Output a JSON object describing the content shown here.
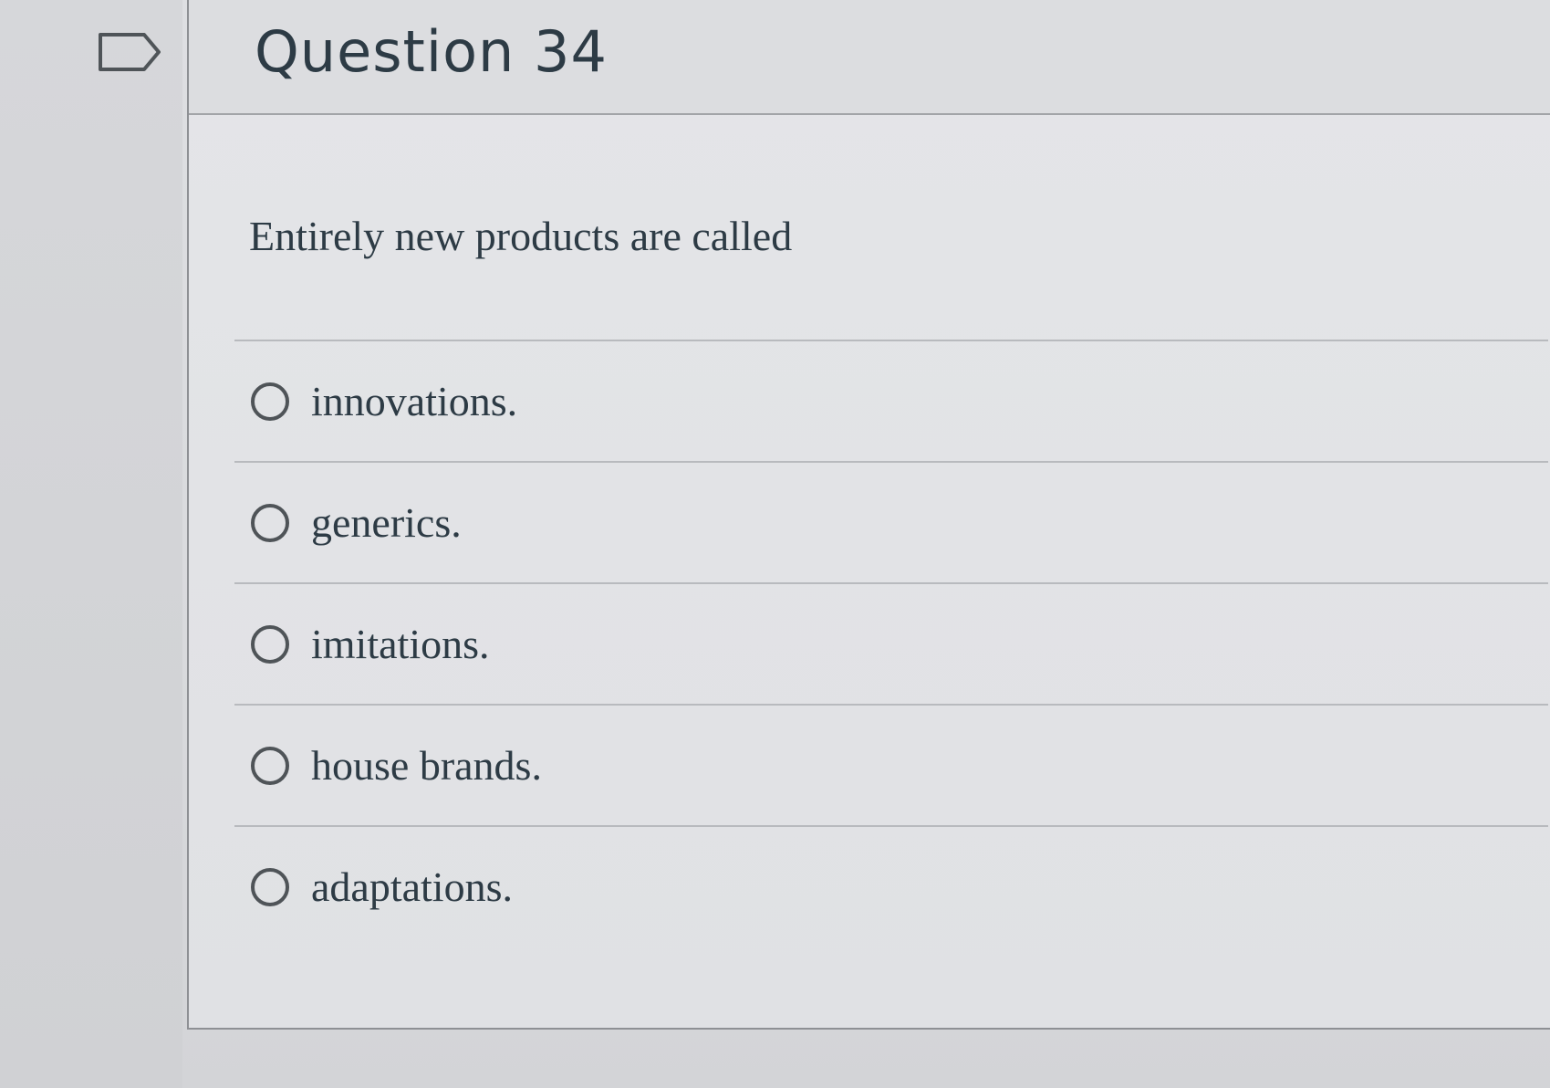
{
  "question": {
    "title": "Question 34",
    "text": "Entirely new products are called",
    "flag_icon": "flag-outline-icon"
  },
  "answers": [
    {
      "label": "innovations."
    },
    {
      "label": "generics."
    },
    {
      "label": "imitations."
    },
    {
      "label": "house brands."
    },
    {
      "label": "adaptations."
    }
  ],
  "colors": {
    "text": "#2d3b45",
    "border": "#8e9094",
    "radio": "#4f5458"
  }
}
